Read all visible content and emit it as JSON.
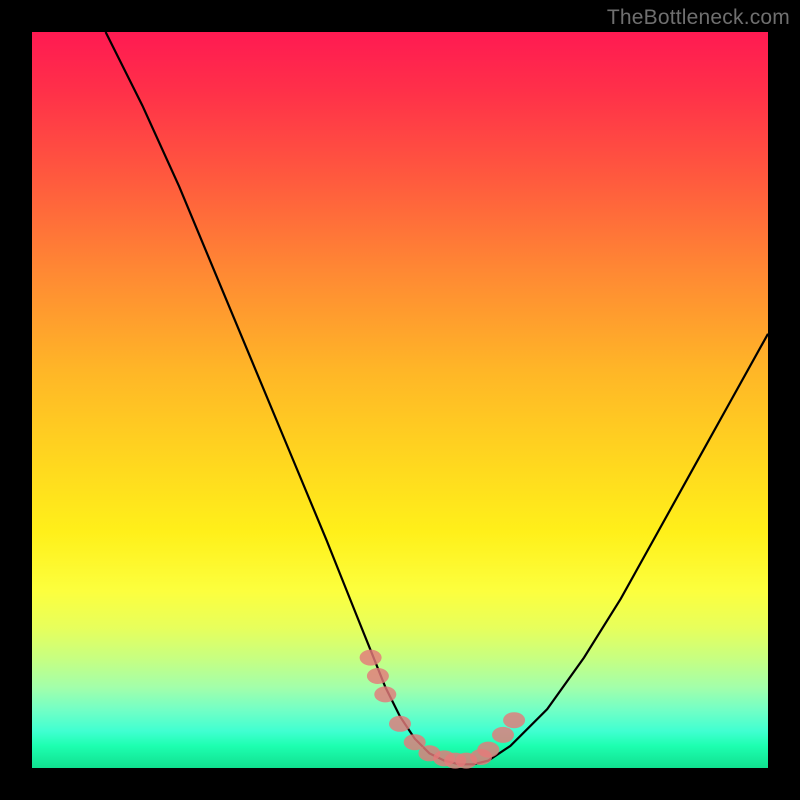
{
  "watermark": "TheBottleneck.com",
  "chart_data": {
    "type": "line",
    "title": "",
    "xlabel": "",
    "ylabel": "",
    "xlim": [
      0,
      100
    ],
    "ylim": [
      0,
      100
    ],
    "series": [
      {
        "name": "curve",
        "x": [
          10,
          15,
          20,
          25,
          30,
          35,
          40,
          42,
          44,
          46,
          48,
          50,
          52,
          54,
          56,
          58,
          60,
          62,
          65,
          70,
          75,
          80,
          85,
          90,
          95,
          100
        ],
        "y": [
          100,
          90,
          79,
          67,
          55,
          43,
          31,
          26,
          21,
          16,
          11,
          7,
          4,
          2,
          1,
          0.5,
          0.5,
          1,
          3,
          8,
          15,
          23,
          32,
          41,
          50,
          59
        ]
      }
    ],
    "markers": {
      "name": "highlight-points",
      "x": [
        46,
        47,
        48,
        50,
        52,
        54,
        56,
        57.5,
        59,
        61,
        62,
        64,
        65.5
      ],
      "y": [
        15,
        12.5,
        10,
        6,
        3.5,
        2,
        1.3,
        1,
        1,
        1.5,
        2.5,
        4.5,
        6.5
      ]
    },
    "gradient_stops": [
      {
        "pos": 0,
        "color": "#ff1a52"
      },
      {
        "pos": 20,
        "color": "#ff5a3e"
      },
      {
        "pos": 46,
        "color": "#ffb627"
      },
      {
        "pos": 68,
        "color": "#fff01a"
      },
      {
        "pos": 85,
        "color": "#c8ff80"
      },
      {
        "pos": 100,
        "color": "#10e08f"
      }
    ]
  }
}
